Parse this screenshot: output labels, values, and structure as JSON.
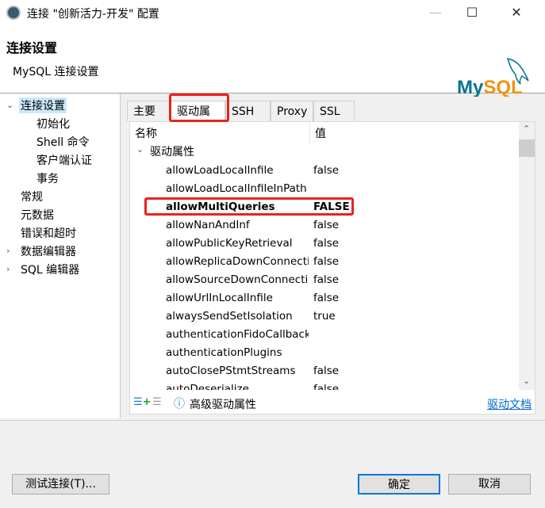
{
  "window": {
    "title": "连接 \"创新活力-开发\" 配置",
    "minimize": "—",
    "maximize": "☐",
    "close": "✕"
  },
  "header": {
    "title": "连接设置",
    "subtitle": "MySQL 连接设置",
    "logo": "MySQL"
  },
  "tree": [
    {
      "label": "连接设置",
      "expanded": true,
      "selected": true,
      "level": 0
    },
    {
      "label": "初始化",
      "level": 1
    },
    {
      "label": "Shell 命令",
      "level": 1
    },
    {
      "label": "客户端认证",
      "level": 1
    },
    {
      "label": "事务",
      "level": 1
    },
    {
      "label": "常规",
      "level": 0
    },
    {
      "label": "元数据",
      "level": 0
    },
    {
      "label": "错误和超时",
      "level": 0
    },
    {
      "label": "数据编辑器",
      "level": 0,
      "collapsed": true
    },
    {
      "label": "SQL 编辑器",
      "level": 0,
      "collapsed": true
    }
  ],
  "tabs": [
    {
      "label": "主要"
    },
    {
      "label": "驱动属性",
      "active": true
    },
    {
      "label": "SSH"
    },
    {
      "label": "Proxy"
    },
    {
      "label": "SSL"
    }
  ],
  "table": {
    "col_name": "名称",
    "col_value": "值",
    "group": "驱动属性",
    "rows": [
      {
        "name": "allowLoadLocalInfile",
        "value": "false"
      },
      {
        "name": "allowLoadLocalInfileInPath",
        "value": ""
      },
      {
        "name": "allowMultiQueries",
        "value": "FALSE",
        "bold": true
      },
      {
        "name": "allowNanAndInf",
        "value": "false"
      },
      {
        "name": "allowPublicKeyRetrieval",
        "value": "false"
      },
      {
        "name": "allowReplicaDownConnections",
        "value": "false"
      },
      {
        "name": "allowSourceDownConnections",
        "value": "false"
      },
      {
        "name": "allowUrlInLocalInfile",
        "value": "false"
      },
      {
        "name": "alwaysSendSetIsolation",
        "value": "true"
      },
      {
        "name": "authenticationFidoCallbackHandler",
        "value": ""
      },
      {
        "name": "authenticationPlugins",
        "value": ""
      },
      {
        "name": "autoClosePStmtStreams",
        "value": "false"
      },
      {
        "name": "autoDeserialize",
        "value": "false"
      }
    ]
  },
  "toolbar": {
    "advanced": "高级驱动属性",
    "docs_link": "驱动文档"
  },
  "footer": {
    "test": "测试连接(T)...",
    "ok": "确定",
    "cancel": "取消"
  },
  "colors": {
    "highlight": "#e8231d",
    "selection": "#cce8ff",
    "link": "#0066cc",
    "mysql_blue": "#00758f",
    "mysql_orange": "#f29111"
  }
}
